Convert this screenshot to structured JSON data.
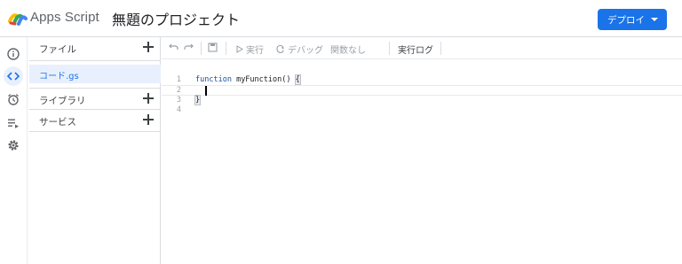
{
  "header": {
    "app_name": "Apps Script",
    "project_title": "無題のプロジェクト",
    "deploy_label": "デプロイ"
  },
  "rail": {
    "items": [
      {
        "icon": "info-icon"
      },
      {
        "icon": "code-icon",
        "active": true
      },
      {
        "icon": "alarm-clock-icon"
      },
      {
        "icon": "executions-icon"
      },
      {
        "icon": "gear-icon"
      }
    ]
  },
  "panel": {
    "files_label": "ファイル",
    "files": [
      "コード.gs"
    ],
    "libraries_label": "ライブラリ",
    "services_label": "サービス"
  },
  "toolbar": {
    "run_label": "実行",
    "debug_label": "デバッグ",
    "function_select": "関数なし",
    "log_label": "実行ログ"
  },
  "editor": {
    "lines": [
      {
        "num": "1",
        "keyword": "function",
        "rest": " myFunction() ",
        "brace": "{"
      },
      {
        "num": "2",
        "text": "  "
      },
      {
        "num": "3",
        "brace": "}"
      },
      {
        "num": "4",
        "text": ""
      }
    ]
  }
}
